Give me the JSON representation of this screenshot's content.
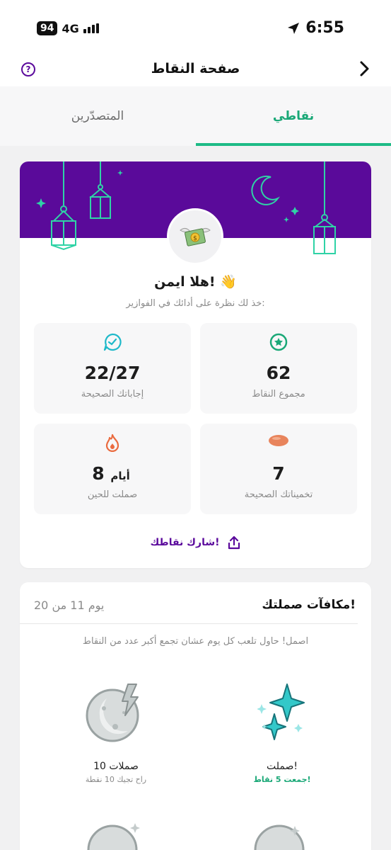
{
  "status": {
    "battery": "94",
    "network": "4G",
    "time": "6:55"
  },
  "header": {
    "title": "صفحة النقاط",
    "help_glyph": "?"
  },
  "tabs": {
    "mine": "نقاطي",
    "leaders": "المتصدّرين"
  },
  "profile": {
    "greeting": "هلا ايمن! 👋",
    "subtitle": "خذ لك نظرة على أدائك في الفوازير:"
  },
  "stats": {
    "points": {
      "value": "62",
      "label": "مجموع النقاط"
    },
    "answers": {
      "value": "22/27",
      "label": "إجاباتك الصحيحة"
    },
    "guesses": {
      "value": "7",
      "label": "تخميناتك الصحيحة"
    },
    "streak": {
      "value": "8",
      "unit": "أيام",
      "label": "صملت للحين"
    }
  },
  "share_label": "شارك نقاطك!",
  "streak_rewards": {
    "title": "مكافآت صملتك!",
    "day_progress": "يوم 11 من 20",
    "subtitle": "اصمل! حاول تلعب كل يوم عشان تجمع أكبر عدد من النقاط",
    "items": [
      {
        "name": "صملت!",
        "sub": "جمعت 5 نقاط!"
      },
      {
        "name": "10 صملات",
        "sub": "راح تجيك 10 نقطة"
      }
    ]
  },
  "colors": {
    "brand_purple": "#5a0a9a",
    "accent_green": "#1dbb86",
    "lantern_teal": "#2fd3a6"
  },
  "icons": [
    "help-icon",
    "back-chevron-icon",
    "money-wings-icon",
    "star-badge-icon",
    "chat-check-icon",
    "date-icon",
    "flame-icon",
    "share-icon",
    "sparkles-icon",
    "moon-lightning-icon"
  ]
}
